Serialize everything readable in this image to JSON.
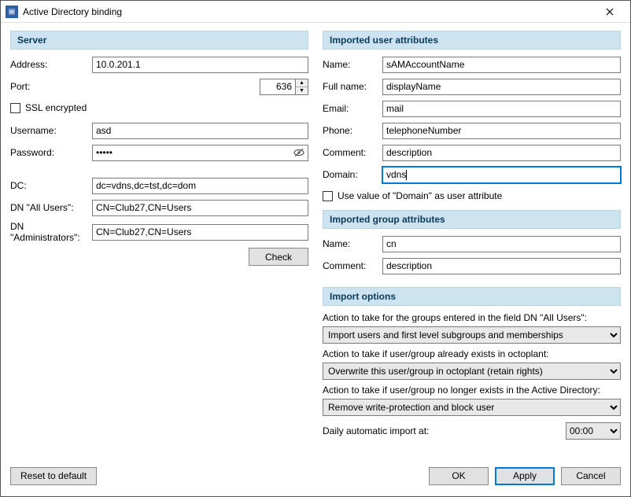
{
  "window": {
    "title": "Active Directory binding"
  },
  "server": {
    "header": "Server",
    "address_label": "Address:",
    "address": "10.0.201.1",
    "port_label": "Port:",
    "port": "636",
    "ssl_label": "SSL encrypted",
    "ssl_checked": false,
    "username_label": "Username:",
    "username": "asd",
    "password_label": "Password:",
    "password": "•••••",
    "dc_label": "DC:",
    "dc": "dc=vdns,dc=tst,dc=dom",
    "dn_allusers_label": "DN \"All Users\":",
    "dn_allusers": "CN=Club27,CN=Users",
    "dn_admins_label": "DN \"Administrators\":",
    "dn_admins": "CN=Club27,CN=Users",
    "check_btn": "Check"
  },
  "user_attrs": {
    "header": "Imported user attributes",
    "name_label": "Name:",
    "name": "sAMAccountName",
    "fullname_label": "Full name:",
    "fullname": "displayName",
    "email_label": "Email:",
    "email": "mail",
    "phone_label": "Phone:",
    "phone": "telephoneNumber",
    "comment_label": "Comment:",
    "comment": "description",
    "domain_label": "Domain:",
    "domain": "vdns",
    "use_domain_label": "Use value of \"Domain\" as user attribute",
    "use_domain_checked": false
  },
  "group_attrs": {
    "header": "Imported group attributes",
    "name_label": "Name:",
    "name": "cn",
    "comment_label": "Comment:",
    "comment": "description"
  },
  "import_options": {
    "header": "Import options",
    "action_groups_label": "Action to take for the groups entered in the field DN \"All Users\":",
    "action_groups_value": "Import users and first level subgroups and memberships",
    "action_exists_label": "Action to take if user/group already exists in octoplant:",
    "action_exists_value": "Overwrite this user/group in octoplant (retain rights)",
    "action_missing_label": "Action to take if user/group no longer exists in the Active Directory:",
    "action_missing_value": "Remove write-protection and block user",
    "daily_import_label": "Daily automatic import at:",
    "daily_import_time": "00:00"
  },
  "footer": {
    "reset": "Reset to default",
    "ok": "OK",
    "apply": "Apply",
    "cancel": "Cancel"
  }
}
